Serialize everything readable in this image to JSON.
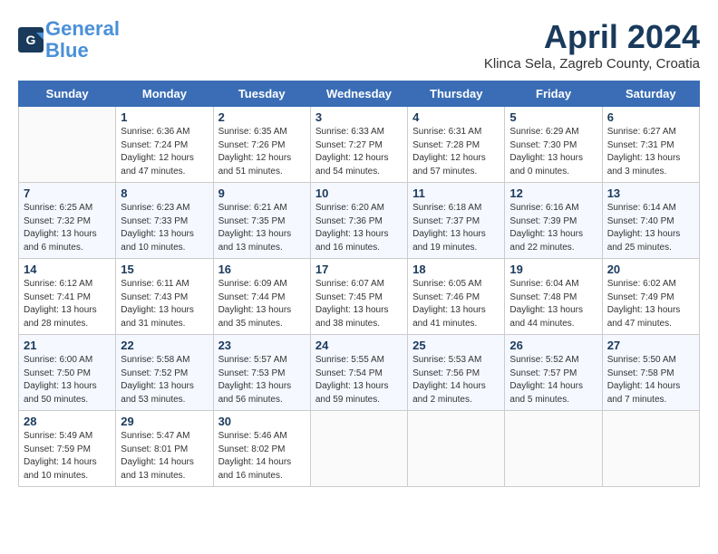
{
  "header": {
    "logo_line1": "General",
    "logo_line2": "Blue",
    "month_title": "April 2024",
    "location": "Klinca Sela, Zagreb County, Croatia"
  },
  "weekdays": [
    "Sunday",
    "Monday",
    "Tuesday",
    "Wednesday",
    "Thursday",
    "Friday",
    "Saturday"
  ],
  "weeks": [
    [
      {
        "day": "",
        "info": ""
      },
      {
        "day": "1",
        "info": "Sunrise: 6:36 AM\nSunset: 7:24 PM\nDaylight: 12 hours\nand 47 minutes."
      },
      {
        "day": "2",
        "info": "Sunrise: 6:35 AM\nSunset: 7:26 PM\nDaylight: 12 hours\nand 51 minutes."
      },
      {
        "day": "3",
        "info": "Sunrise: 6:33 AM\nSunset: 7:27 PM\nDaylight: 12 hours\nand 54 minutes."
      },
      {
        "day": "4",
        "info": "Sunrise: 6:31 AM\nSunset: 7:28 PM\nDaylight: 12 hours\nand 57 minutes."
      },
      {
        "day": "5",
        "info": "Sunrise: 6:29 AM\nSunset: 7:30 PM\nDaylight: 13 hours\nand 0 minutes."
      },
      {
        "day": "6",
        "info": "Sunrise: 6:27 AM\nSunset: 7:31 PM\nDaylight: 13 hours\nand 3 minutes."
      }
    ],
    [
      {
        "day": "7",
        "info": "Sunrise: 6:25 AM\nSunset: 7:32 PM\nDaylight: 13 hours\nand 6 minutes."
      },
      {
        "day": "8",
        "info": "Sunrise: 6:23 AM\nSunset: 7:33 PM\nDaylight: 13 hours\nand 10 minutes."
      },
      {
        "day": "9",
        "info": "Sunrise: 6:21 AM\nSunset: 7:35 PM\nDaylight: 13 hours\nand 13 minutes."
      },
      {
        "day": "10",
        "info": "Sunrise: 6:20 AM\nSunset: 7:36 PM\nDaylight: 13 hours\nand 16 minutes."
      },
      {
        "day": "11",
        "info": "Sunrise: 6:18 AM\nSunset: 7:37 PM\nDaylight: 13 hours\nand 19 minutes."
      },
      {
        "day": "12",
        "info": "Sunrise: 6:16 AM\nSunset: 7:39 PM\nDaylight: 13 hours\nand 22 minutes."
      },
      {
        "day": "13",
        "info": "Sunrise: 6:14 AM\nSunset: 7:40 PM\nDaylight: 13 hours\nand 25 minutes."
      }
    ],
    [
      {
        "day": "14",
        "info": "Sunrise: 6:12 AM\nSunset: 7:41 PM\nDaylight: 13 hours\nand 28 minutes."
      },
      {
        "day": "15",
        "info": "Sunrise: 6:11 AM\nSunset: 7:43 PM\nDaylight: 13 hours\nand 31 minutes."
      },
      {
        "day": "16",
        "info": "Sunrise: 6:09 AM\nSunset: 7:44 PM\nDaylight: 13 hours\nand 35 minutes."
      },
      {
        "day": "17",
        "info": "Sunrise: 6:07 AM\nSunset: 7:45 PM\nDaylight: 13 hours\nand 38 minutes."
      },
      {
        "day": "18",
        "info": "Sunrise: 6:05 AM\nSunset: 7:46 PM\nDaylight: 13 hours\nand 41 minutes."
      },
      {
        "day": "19",
        "info": "Sunrise: 6:04 AM\nSunset: 7:48 PM\nDaylight: 13 hours\nand 44 minutes."
      },
      {
        "day": "20",
        "info": "Sunrise: 6:02 AM\nSunset: 7:49 PM\nDaylight: 13 hours\nand 47 minutes."
      }
    ],
    [
      {
        "day": "21",
        "info": "Sunrise: 6:00 AM\nSunset: 7:50 PM\nDaylight: 13 hours\nand 50 minutes."
      },
      {
        "day": "22",
        "info": "Sunrise: 5:58 AM\nSunset: 7:52 PM\nDaylight: 13 hours\nand 53 minutes."
      },
      {
        "day": "23",
        "info": "Sunrise: 5:57 AM\nSunset: 7:53 PM\nDaylight: 13 hours\nand 56 minutes."
      },
      {
        "day": "24",
        "info": "Sunrise: 5:55 AM\nSunset: 7:54 PM\nDaylight: 13 hours\nand 59 minutes."
      },
      {
        "day": "25",
        "info": "Sunrise: 5:53 AM\nSunset: 7:56 PM\nDaylight: 14 hours\nand 2 minutes."
      },
      {
        "day": "26",
        "info": "Sunrise: 5:52 AM\nSunset: 7:57 PM\nDaylight: 14 hours\nand 5 minutes."
      },
      {
        "day": "27",
        "info": "Sunrise: 5:50 AM\nSunset: 7:58 PM\nDaylight: 14 hours\nand 7 minutes."
      }
    ],
    [
      {
        "day": "28",
        "info": "Sunrise: 5:49 AM\nSunset: 7:59 PM\nDaylight: 14 hours\nand 10 minutes."
      },
      {
        "day": "29",
        "info": "Sunrise: 5:47 AM\nSunset: 8:01 PM\nDaylight: 14 hours\nand 13 minutes."
      },
      {
        "day": "30",
        "info": "Sunrise: 5:46 AM\nSunset: 8:02 PM\nDaylight: 14 hours\nand 16 minutes."
      },
      {
        "day": "",
        "info": ""
      },
      {
        "day": "",
        "info": ""
      },
      {
        "day": "",
        "info": ""
      },
      {
        "day": "",
        "info": ""
      }
    ]
  ]
}
